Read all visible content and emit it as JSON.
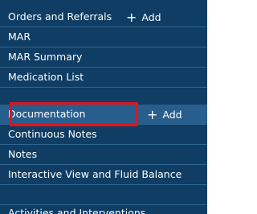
{
  "nav": {
    "items": [
      {
        "label": "Orders and Referrals",
        "add": "Add"
      },
      {
        "label": "MAR"
      },
      {
        "label": "MAR Summary"
      },
      {
        "label": "Medication List"
      },
      {
        "label": "Documentation",
        "add": "Add",
        "active": true
      },
      {
        "label": "Continuous Notes"
      },
      {
        "label": "Notes"
      },
      {
        "label": "Interactive View and Fluid Balance"
      },
      {
        "label": "Activities and Interventions"
      }
    ]
  },
  "colors": {
    "nav_bg": "#0f3d63",
    "active_row": "#285e8e",
    "divider": "#2f6791",
    "highlight_box": "#e0151b",
    "text": "#ffffff"
  }
}
